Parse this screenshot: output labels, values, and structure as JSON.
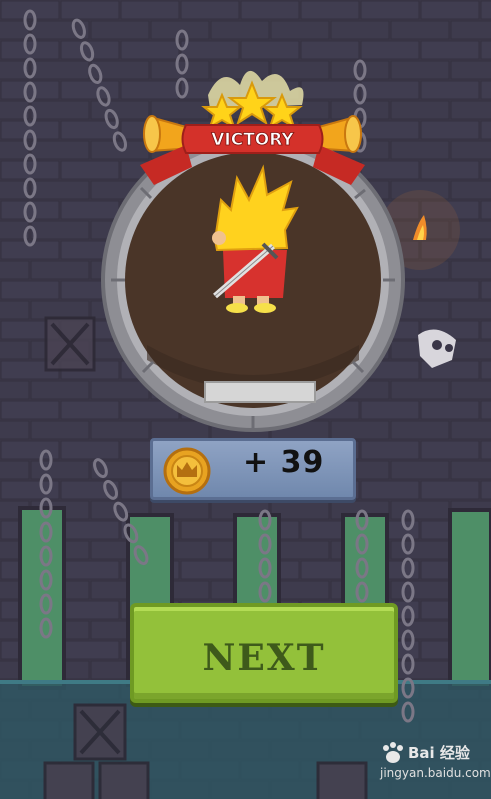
{
  "banner": {
    "title": "VICTORY"
  },
  "reward": {
    "amount_text": "+ 39",
    "icon": "coin-crown-icon"
  },
  "next_button": {
    "label": "NEXT"
  },
  "watermark": {
    "brand": "Bai 经验",
    "url": "jingyan.baidu.com"
  },
  "colors": {
    "background": "#3a3648",
    "ring": "#a9a9a9",
    "portal_inside": "#4a3528",
    "banner_red": "#d4312a",
    "button_green": "#93c13a",
    "coin_gold": "#e8a321",
    "badge_blue": "#7f96bb"
  },
  "hero": {
    "hair": "spiky-yellow",
    "cape": "red",
    "weapon": "sword"
  }
}
